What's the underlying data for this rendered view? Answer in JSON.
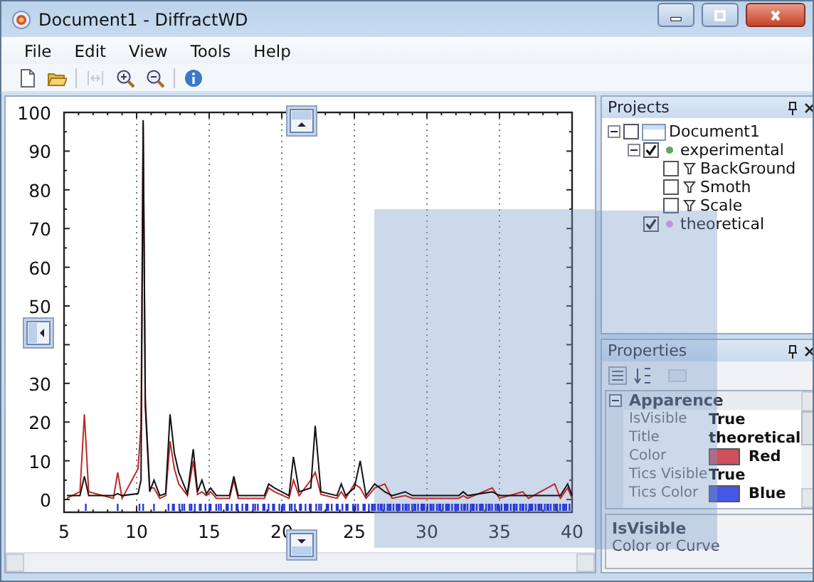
{
  "window": {
    "title": "Document1 - DiffractWD"
  },
  "menu": [
    "File",
    "Edit",
    "View",
    "Tools",
    "Help"
  ],
  "toolbar": [
    [
      {
        "kind": "new",
        "disabled": false
      },
      {
        "kind": "open",
        "disabled": false
      }
    ],
    [
      {
        "kind": "fit",
        "disabled": true
      },
      {
        "kind": "zoom_in",
        "disabled": false
      },
      {
        "kind": "zoom_out",
        "disabled": false
      }
    ],
    [
      {
        "kind": "info",
        "disabled": false
      }
    ]
  ],
  "chart": {
    "chart_data": {
      "type": "line",
      "grid": true,
      "xlim": [
        5,
        40
      ],
      "ylim": [
        -3.3,
        100
      ],
      "xticks": [
        5,
        10,
        15,
        20,
        25,
        30,
        35,
        40
      ],
      "yticks": [
        0,
        10,
        20,
        30,
        50,
        60,
        70,
        80,
        90,
        100
      ],
      "x": [
        5.2,
        6.1,
        6.4,
        6.7,
        8.4,
        8.7,
        9.0,
        10.1,
        10.3,
        10.45,
        10.6,
        10.9,
        11.2,
        11.6,
        12.0,
        12.3,
        12.6,
        12.9,
        13.5,
        13.9,
        14.2,
        14.5,
        14.8,
        15.1,
        15.5,
        16.4,
        16.7,
        17.0,
        18.8,
        19.1,
        19.5,
        20.5,
        20.8,
        21.2,
        22.0,
        22.3,
        22.7,
        23.8,
        24.1,
        24.4,
        25.0,
        25.4,
        25.8,
        26.4,
        27.1,
        27.6,
        28.5,
        29.0,
        32.2,
        32.5,
        32.8,
        34.5,
        35.0,
        36.6,
        37.0,
        38.8,
        39.2,
        39.7,
        40.0
      ],
      "series": [
        {
          "color": "#c02828",
          "values": [
            0.3,
            2,
            22,
            2,
            0.3,
            7,
            0.3,
            8,
            19,
            97,
            26,
            3,
            3,
            0.3,
            1,
            15,
            8,
            4,
            1,
            10,
            1.3,
            2,
            1,
            2,
            0.3,
            0.3,
            5,
            0.3,
            0.3,
            3,
            2,
            0.3,
            5,
            1,
            5,
            7,
            1.3,
            0.3,
            2,
            0.3,
            4,
            3,
            0.3,
            3,
            4,
            0.3,
            1,
            0.3,
            0.3,
            1,
            0.3,
            3,
            0.3,
            2,
            0.3,
            4,
            0.3,
            3,
            0.3
          ]
        },
        {
          "color": "#111111",
          "values": [
            1,
            1,
            6,
            1,
            1,
            1.5,
            1,
            1.5,
            5,
            98,
            24,
            2,
            5,
            1,
            1.5,
            22,
            12,
            7,
            1.5,
            13,
            2,
            5,
            1.5,
            3,
            1,
            1,
            6,
            1,
            1,
            4,
            3,
            1,
            11,
            2,
            3,
            19,
            2,
            1,
            4,
            1,
            3,
            10,
            1,
            4,
            2,
            1,
            2,
            1,
            1,
            2,
            1,
            2,
            1,
            1,
            1,
            1,
            1,
            4,
            1
          ]
        }
      ]
    }
  },
  "projects": {
    "title": "Projects",
    "tree": [
      {
        "label": "Document1",
        "kind": "document",
        "checked": false,
        "expanded": true,
        "children": [
          {
            "label": "experimental",
            "kind": "curve",
            "color": "#5aa85a",
            "checked": true,
            "expanded": true,
            "children": [
              {
                "label": "BackGround",
                "kind": "filter",
                "checked": false
              },
              {
                "label": "Smoth",
                "kind": "filter",
                "checked": false
              },
              {
                "label": "Scale",
                "kind": "filter",
                "checked": false
              }
            ]
          },
          {
            "label": "theoretical",
            "kind": "curve",
            "color": "#c890d8",
            "checked": true
          }
        ]
      }
    ]
  },
  "properties": {
    "title": "Properties",
    "category": "Apparence",
    "expanded": true,
    "rows": [
      {
        "name": "IsVisible",
        "value": "True"
      },
      {
        "name": "Title",
        "value": "theoretical"
      },
      {
        "name": "Color",
        "value": "Red",
        "color": "#d0505e"
      },
      {
        "name": "Tics Visible",
        "value": "True"
      },
      {
        "name": "Tics Color",
        "value": "Blue",
        "color": "#4656e6"
      }
    ],
    "description": {
      "title": "IsVisible",
      "text": "Color or Curve"
    }
  }
}
